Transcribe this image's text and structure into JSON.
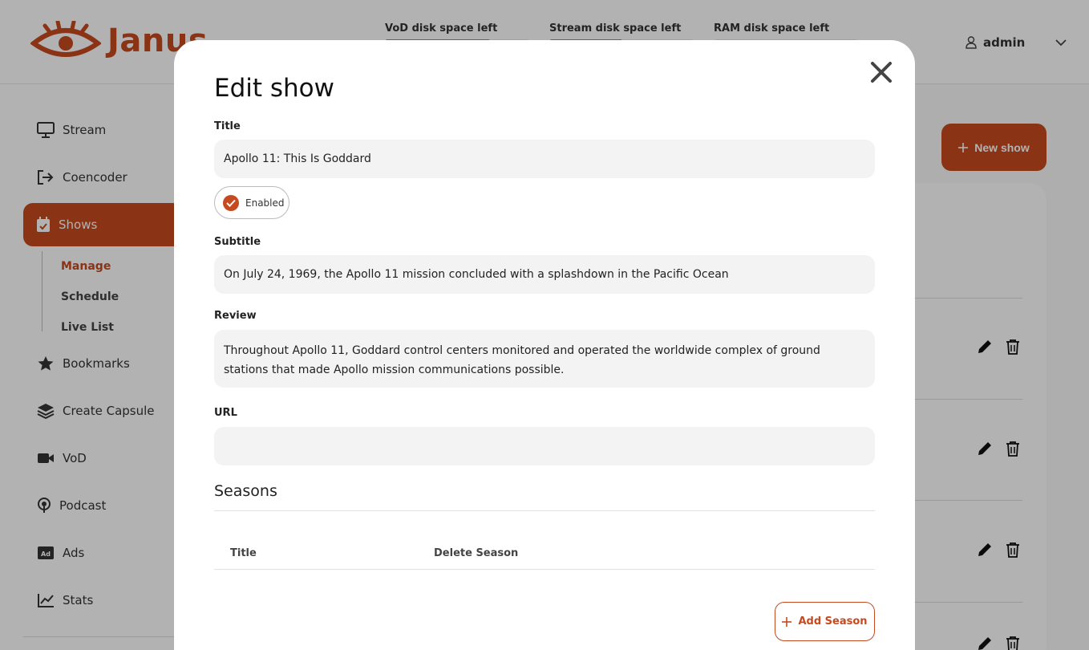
{
  "app": {
    "name": "Janus"
  },
  "topbar": {
    "disks": [
      {
        "label": "VoD disk space left",
        "fill": 0.72
      },
      {
        "label": "Stream disk space left",
        "fill": 0.5
      },
      {
        "label": "RAM disk space left",
        "fill": 0.0
      }
    ],
    "user": "admin"
  },
  "sidebar": {
    "items": [
      {
        "label": "Stream",
        "icon": "monitor-icon"
      },
      {
        "label": "Coencoder",
        "icon": "sign-out-icon"
      },
      {
        "label": "Shows",
        "icon": "calendar-check-icon"
      },
      {
        "label": "Bookmarks",
        "icon": "star-icon"
      },
      {
        "label": "Create Capsule",
        "icon": "layers-icon"
      },
      {
        "label": "VoD",
        "icon": "video-icon"
      },
      {
        "label": "Podcast",
        "icon": "podcast-icon"
      },
      {
        "label": "Ads",
        "icon": "ad-icon"
      },
      {
        "label": "Stats",
        "icon": "chart-line-icon"
      }
    ],
    "subitems": [
      "Manage",
      "Schedule",
      "Live List"
    ]
  },
  "main": {
    "new_show_label": "New show"
  },
  "modal": {
    "title": "Edit show",
    "title_label": "Title",
    "title_value": "Apollo 11: This Is Goddard",
    "enabled_label": "Enabled",
    "subtitle_label": "Subtitle",
    "subtitle_value": "On July 24, 1969, the Apollo 11 mission concluded with a splashdown in the Pacific Ocean",
    "review_label": "Review",
    "review_value": "Throughout Apollo 11, Goddard control centers monitored and operated the worldwide complex of ground stations that made Apollo mission communications possible.",
    "url_label": "URL",
    "url_value": "",
    "seasons_title": "Seasons",
    "seasons_columns": [
      "Title",
      "Delete Season"
    ],
    "add_season_label": "Add Season"
  },
  "colors": {
    "accent": "#c64a1f",
    "overlay": "rgba(0,0,0,0.30)"
  }
}
